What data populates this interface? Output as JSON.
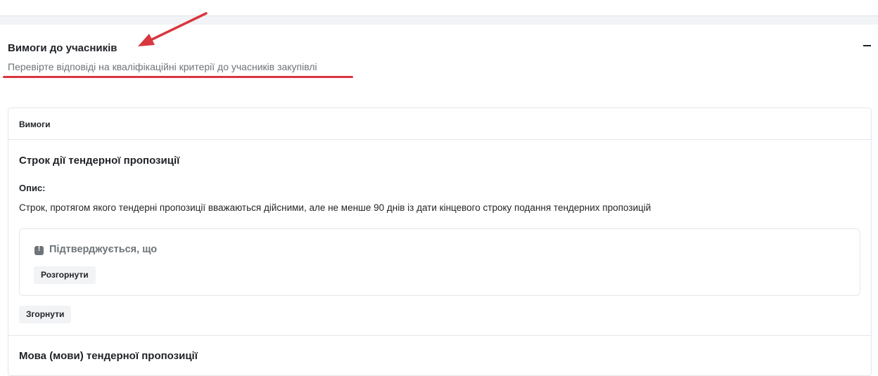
{
  "section": {
    "title": "Вимоги до учасників",
    "subtitle": "Перевірте відповіді на кваліфікаційні критерії до учасників закупівлі"
  },
  "card": {
    "header": "Вимоги",
    "requirement": {
      "title": "Строк дії тендерної пропозиції",
      "description_label": "Опис:",
      "description": "Строк, протягом якого тендерні пропозиції вважаються дійсними, але не менше 90 днів із дати кінцевого строку подання тендерних пропозицій",
      "confirmation": "Підтверджується, що",
      "expand_label": "Розгорнути"
    },
    "collapse_label": "Згорнути",
    "next_requirement_title": "Мова (мови) тендерної пропозиції"
  },
  "annotation_color": "#d9363e"
}
